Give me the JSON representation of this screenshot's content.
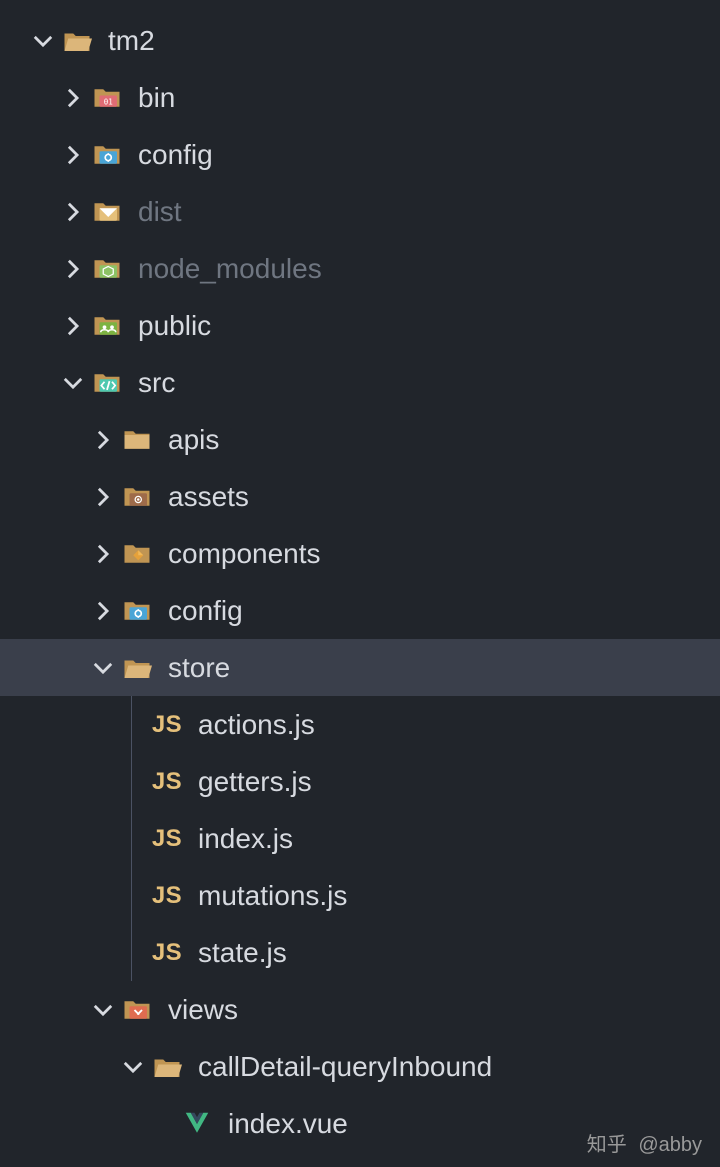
{
  "tree": {
    "root": {
      "label": "tm2",
      "expanded": true,
      "children": [
        {
          "label": "bin",
          "icon": "folder-binary",
          "expanded": false
        },
        {
          "label": "config",
          "icon": "folder-config",
          "expanded": false
        },
        {
          "label": "dist",
          "icon": "folder-dist",
          "expanded": false,
          "dimmed": true
        },
        {
          "label": "node_modules",
          "icon": "folder-node",
          "expanded": false,
          "dimmed": true
        },
        {
          "label": "public",
          "icon": "folder-public",
          "expanded": false
        },
        {
          "label": "src",
          "icon": "folder-src",
          "expanded": true,
          "children": [
            {
              "label": "apis",
              "icon": "folder-generic",
              "expanded": false
            },
            {
              "label": "assets",
              "icon": "folder-assets",
              "expanded": false
            },
            {
              "label": "components",
              "icon": "folder-components",
              "expanded": false
            },
            {
              "label": "config",
              "icon": "folder-config",
              "expanded": false
            },
            {
              "label": "store",
              "icon": "folder-open",
              "expanded": true,
              "selected": true,
              "children": [
                {
                  "label": "actions.js",
                  "icon": "js-file"
                },
                {
                  "label": "getters.js",
                  "icon": "js-file"
                },
                {
                  "label": "index.js",
                  "icon": "js-file"
                },
                {
                  "label": "mutations.js",
                  "icon": "js-file"
                },
                {
                  "label": "state.js",
                  "icon": "js-file"
                }
              ]
            },
            {
              "label": "views",
              "icon": "folder-views",
              "expanded": true,
              "children": [
                {
                  "label": "callDetail-queryInbound",
                  "icon": "folder-open",
                  "expanded": true,
                  "children": [
                    {
                      "label": "index.vue",
                      "icon": "vue-file"
                    }
                  ]
                }
              ]
            }
          ]
        }
      ]
    }
  },
  "watermark": {
    "platform": "知乎",
    "author": "@abby"
  },
  "indent_base": 30,
  "indent_step": 30
}
